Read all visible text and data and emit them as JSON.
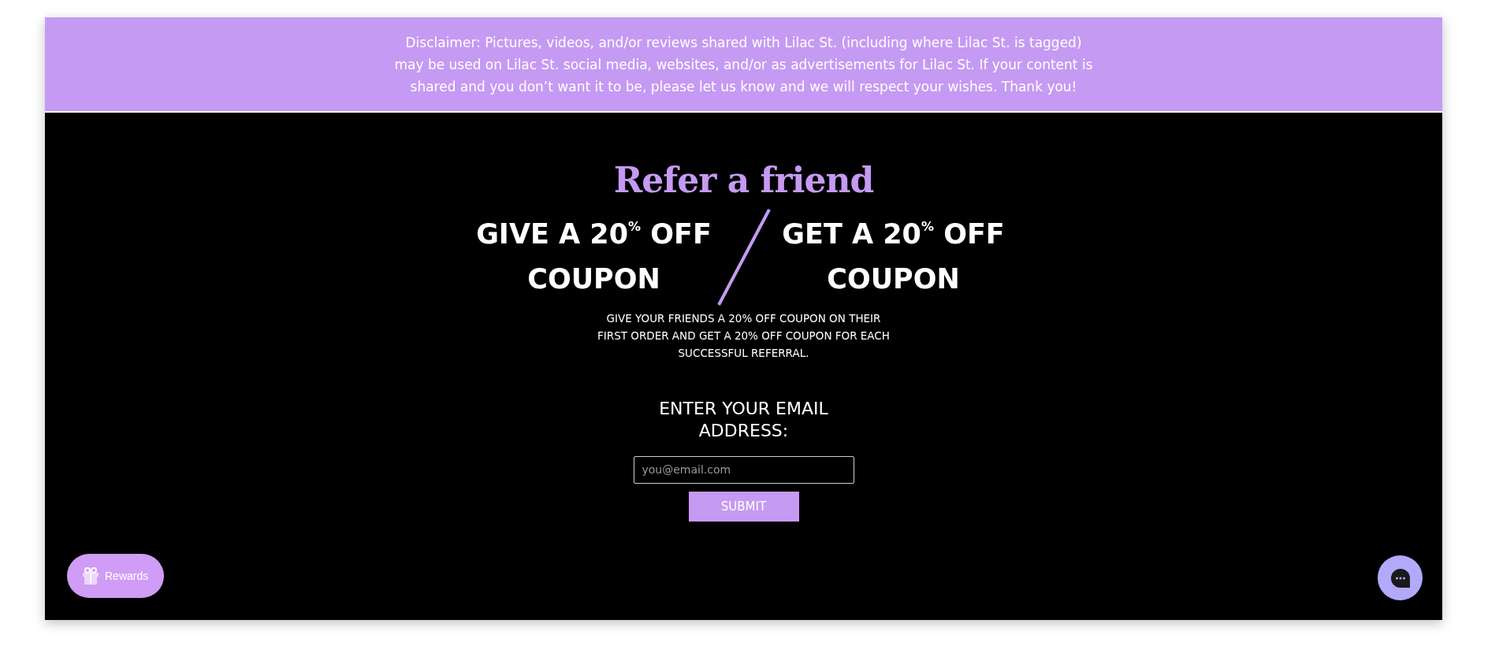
{
  "disclaimer": "Disclaimer: Pictures, videos, and/or reviews shared with Lilac St. (including where Lilac St. is tagged) may be used on Lilac St. social media, websites, and/or as advertisements for Lilac St. If your content is shared and you don’t want it to be, please let us know and we will respect your wishes. Thank you!",
  "title": "Refer a friend",
  "offers": [
    "GIVE A 20$^{%}$ OFF COUPON",
    "GET A 20$^{%}$ OFF COUPON"
  ],
  "description": "GIVE YOUR FRIENDS A 20% OFF COUPON ON THEIR FIRST ORDER AND GET A 20% OFF COUPON FOR EACH SUCCESSFUL REFERRAL.",
  "email_prompt": "ENTER YOUR EMAIL ADDRESS:",
  "email_field": {
    "placeholder": "you@email.com"
  },
  "submit_button": "SUBMIT",
  "rewards_button": "Rewards"
}
